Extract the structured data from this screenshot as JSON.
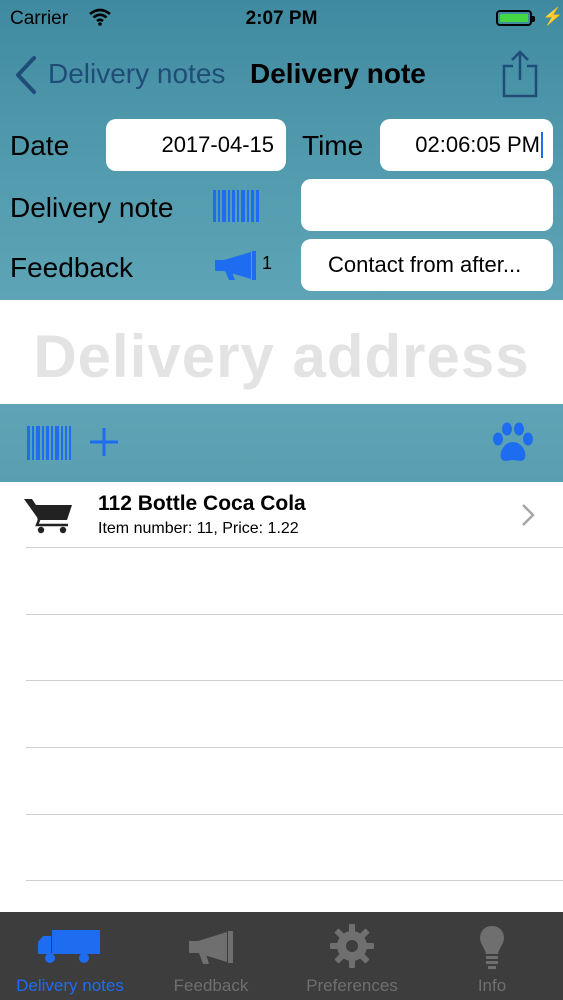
{
  "status_bar": {
    "carrier": "Carrier",
    "time": "2:07 PM",
    "battery_level": 1.0
  },
  "nav": {
    "back_label": "Delivery notes",
    "title": "Delivery note"
  },
  "form": {
    "date_label": "Date",
    "date_value": "2017-04-15",
    "time_label": "Time",
    "time_value": "02:06:05 PM",
    "delivery_note_label": "Delivery note",
    "delivery_note_value": "",
    "feedback_label": "Feedback",
    "feedback_count": "1",
    "feedback_value": "Contact from after..."
  },
  "address": {
    "placeholder": "Delivery address"
  },
  "items": [
    {
      "title": "112 Bottle Coca Cola",
      "subtitle": "Item number: 11, Price: 1.22"
    }
  ],
  "tabs": [
    {
      "label": "Delivery notes",
      "icon": "truck-icon",
      "active": true
    },
    {
      "label": "Feedback",
      "icon": "megaphone-icon",
      "active": false
    },
    {
      "label": "Preferences",
      "icon": "gear-icon",
      "active": false
    },
    {
      "label": "Info",
      "icon": "lightbulb-icon",
      "active": false
    }
  ],
  "colors": {
    "header": "#4e97ab",
    "accent": "#1e6cf0",
    "tabbar": "#3d3d3d"
  }
}
